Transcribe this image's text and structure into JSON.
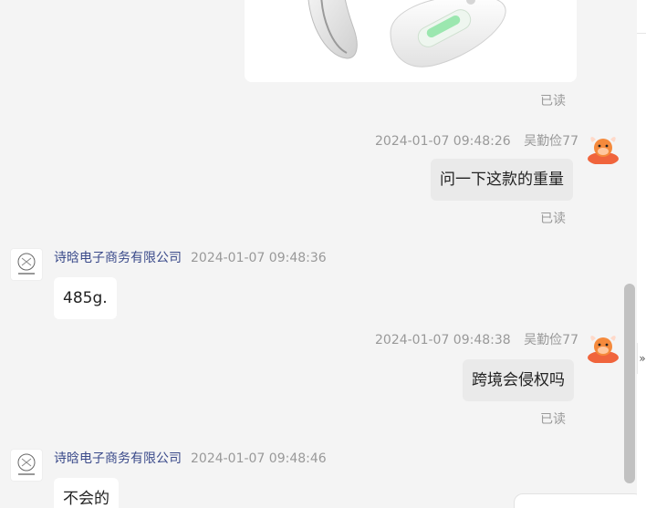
{
  "messages": [
    {
      "read_label": "已读"
    },
    {
      "timestamp": "2024-01-07 09:48:26",
      "sender": "吴勤俭77",
      "text": "问一下这款的重量",
      "read_label": "已读"
    },
    {
      "sender": "诗晗电子商务有限公司",
      "timestamp": "2024-01-07 09:48:36",
      "text": "485g."
    },
    {
      "timestamp": "2024-01-07 09:48:38",
      "sender": "吴勤俭77",
      "text": "跨境会侵权吗",
      "read_label": "已读"
    },
    {
      "sender": "诗晗电子商务有限公司",
      "timestamp": "2024-01-07 09:48:46",
      "text": "不会的"
    }
  ],
  "panel": {
    "collapse_glyph": "»"
  },
  "colors": {
    "background": "#f4f4f4",
    "self_bubble": "#eaeaea",
    "other_bubble": "#ffffff",
    "shop_name": "#3a4a8a",
    "meta_text": "#999999",
    "avatar_orange": "#f0643c"
  },
  "icons": {
    "user_avatar": "cartoon-bull-avatar",
    "shop_avatar": "shop-logo-avatar",
    "product_image": "neck-massager-product-photo"
  }
}
